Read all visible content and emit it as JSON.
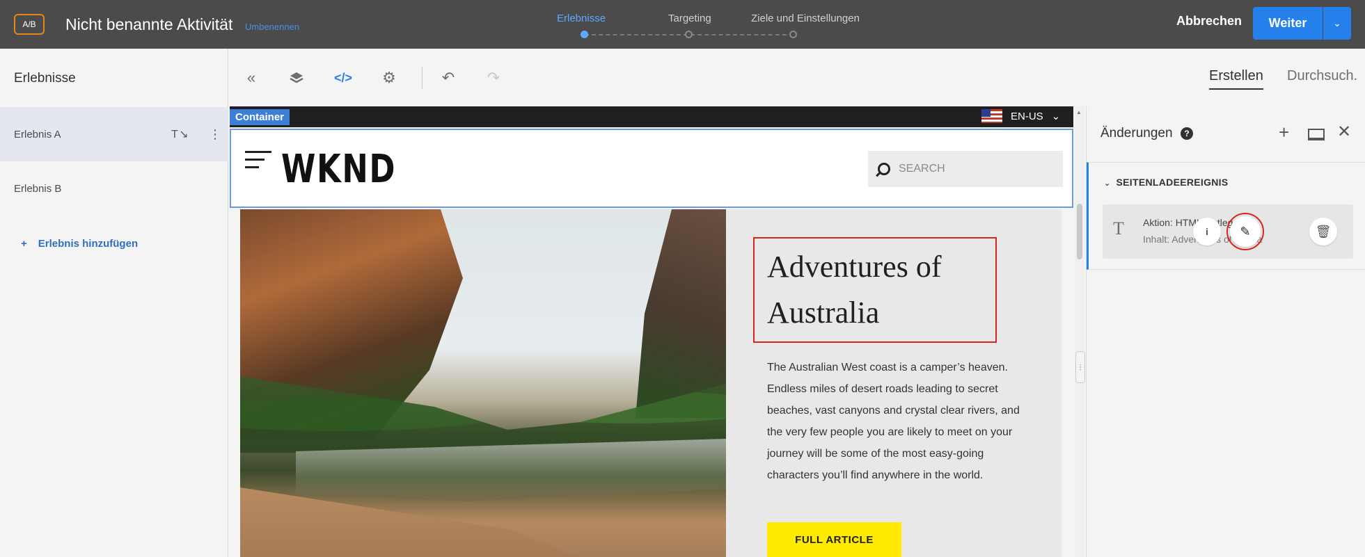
{
  "topbar": {
    "badge": "A/B",
    "activity_title": "Nicht benannte Aktivität",
    "rename": "Umbenennen",
    "steps": [
      "Erlebnisse",
      "Targeting",
      "Ziele und Einstellungen"
    ],
    "active_step": "Erlebnisse",
    "cancel": "Abbrechen",
    "next": "Weiter",
    "accent_color": "#2680eb"
  },
  "left_panel": {
    "header": "Erlebnisse",
    "experiences": [
      "Erlebnis A",
      "Erlebnis B"
    ],
    "selected": "Erlebnis A",
    "add_experience": "Erlebnis hinzufügen"
  },
  "toolbar": {
    "icons": [
      "collapse-icon",
      "layers-icon",
      "code-icon",
      "gear-icon",
      "undo-icon",
      "redo-icon"
    ],
    "tab_create": "Erstellen",
    "tab_browse": "Durchsuch."
  },
  "site": {
    "container_label": "Container",
    "language": "EN-US",
    "logo": "WKND",
    "search_placeholder": "SEARCH",
    "hero_title": "Adventures of Australia",
    "hero_body": "The Australian West coast is a camper’s heaven. Endless miles of desert roads leading to secret beaches, vast canyons and crystal clear rivers, and the very few people you are likely to meet on your journey will be some of the most easy-going characters you’ll find anywhere in the world.",
    "cta": "FULL ARTICLE",
    "cta_color": "#ffea00",
    "highlight_color": "#d7261e"
  },
  "changes_panel": {
    "title": "Änderungen",
    "event": "SEITENLADEEREIGNIS",
    "action": "Aktion: HTML festlegen",
    "content": "Inhalt: Adventures of Austra"
  }
}
